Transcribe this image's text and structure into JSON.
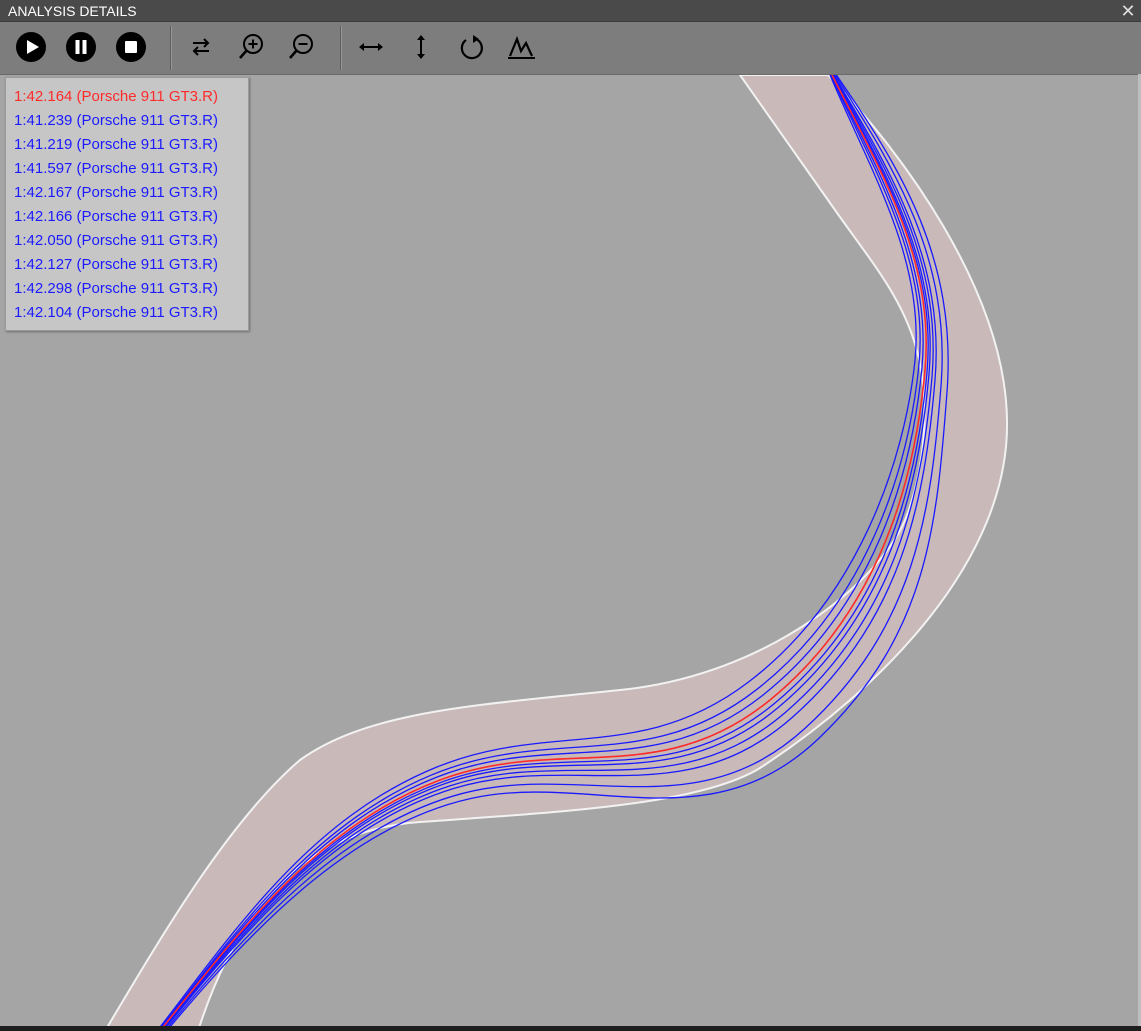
{
  "window": {
    "title": "ANALYSIS DETAILS",
    "close_icon": "close-icon"
  },
  "toolbar": {
    "buttons": [
      {
        "name": "play-button",
        "icon": "play-icon"
      },
      {
        "name": "pause-button",
        "icon": "pause-icon"
      },
      {
        "name": "stop-button",
        "icon": "stop-icon"
      },
      {
        "name": "swap-direction-button",
        "icon": "swap-arrows-icon"
      },
      {
        "name": "zoom-in-button",
        "icon": "zoom-in-icon"
      },
      {
        "name": "zoom-out-button",
        "icon": "zoom-out-icon"
      },
      {
        "name": "fit-horizontal-button",
        "icon": "horizontal-arrows-icon"
      },
      {
        "name": "fit-vertical-button",
        "icon": "vertical-arrows-icon"
      },
      {
        "name": "rotate-button",
        "icon": "rotate-icon"
      },
      {
        "name": "graph-button",
        "icon": "graph-icon"
      }
    ]
  },
  "colors": {
    "reference_lap": "#ff2a2a",
    "comparison_lap": "#1a1aff",
    "track_fill": "#c9b9b9",
    "track_edge": "#f2f2f2",
    "background": "#a5a5a5"
  },
  "laps": [
    {
      "label": "1:42.164 (Porsche 911 GT3.R)",
      "color": "#ff2a2a",
      "reference": true
    },
    {
      "label": "1:41.239 (Porsche 911 GT3.R)",
      "color": "#1a1aff"
    },
    {
      "label": "1:41.219 (Porsche 911 GT3.R)",
      "color": "#1a1aff"
    },
    {
      "label": "1:41.597 (Porsche 911 GT3.R)",
      "color": "#1a1aff"
    },
    {
      "label": "1:42.167 (Porsche 911 GT3.R)",
      "color": "#1a1aff"
    },
    {
      "label": "1:42.166 (Porsche 911 GT3.R)",
      "color": "#1a1aff"
    },
    {
      "label": "1:42.050 (Porsche 911 GT3.R)",
      "color": "#1a1aff"
    },
    {
      "label": "1:42.127 (Porsche 911 GT3.R)",
      "color": "#1a1aff"
    },
    {
      "label": "1:42.298 (Porsche 911 GT3.R)",
      "color": "#1a1aff"
    },
    {
      "label": "1:42.104 (Porsche 911 GT3.R)",
      "color": "#1a1aff"
    }
  ]
}
